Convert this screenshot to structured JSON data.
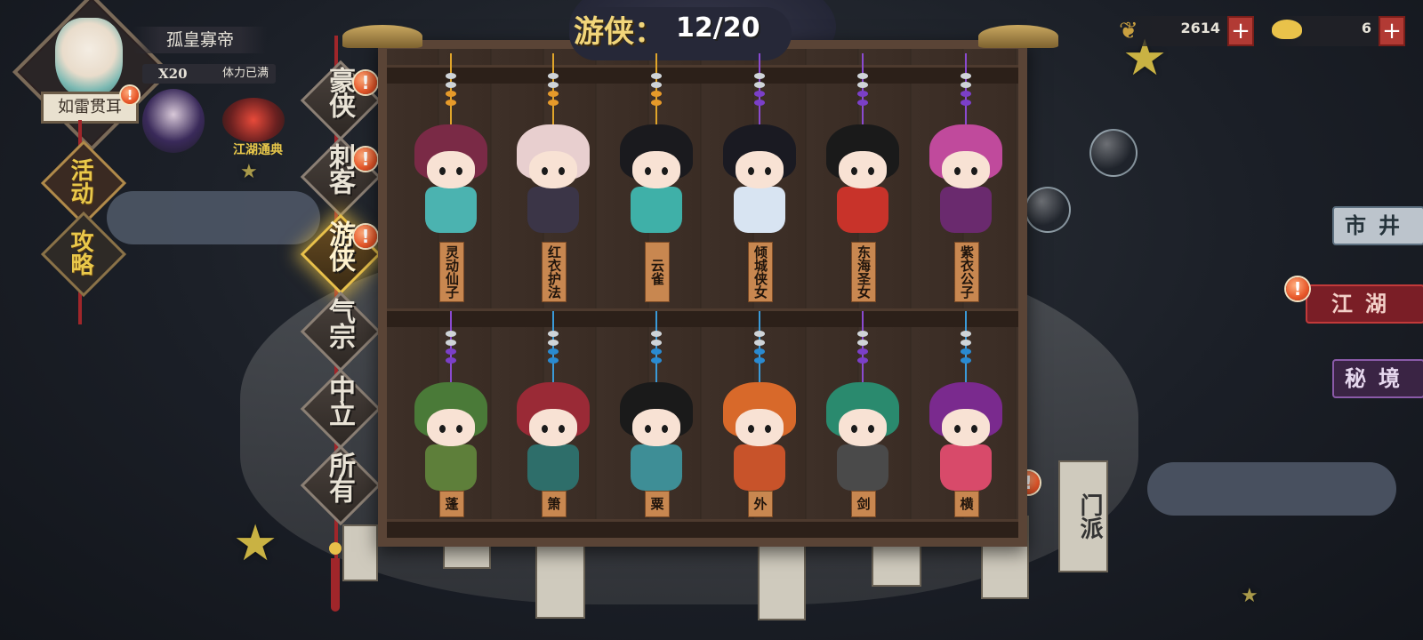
{
  "header": {
    "title": "游侠",
    "separator": "：",
    "count": "12/20"
  },
  "player": {
    "name": "孤皇寡帝",
    "stamina_count": "X20",
    "stamina_state": "体力已满",
    "title": "如雷贯耳"
  },
  "left_menu": {
    "activity": "活动",
    "strategy": "攻略",
    "codex": "江湖通典"
  },
  "categories": [
    {
      "label": "豪侠",
      "badge": "!"
    },
    {
      "label": "刺客",
      "badge": "!"
    },
    {
      "label": "游侠",
      "badge": "!"
    },
    {
      "label": "气宗",
      "badge": ""
    },
    {
      "label": "中立",
      "badge": ""
    },
    {
      "label": "所有",
      "badge": ""
    }
  ],
  "characters_row1": [
    {
      "name": "灵动仙子",
      "hair": "#7a2a46",
      "torso": "#4bb3b0",
      "string": "#e0a52a",
      "bead": "#e69a2a"
    },
    {
      "name": "红衣护法",
      "hair": "#e8cfcf",
      "torso": "#3b3547",
      "string": "#e0a52a",
      "bead": "#e69a2a"
    },
    {
      "name": "云雀",
      "hair": "#1a1a1e",
      "torso": "#3fb0a8",
      "string": "#e0a52a",
      "bead": "#e69a2a"
    },
    {
      "name": "倾城侠女",
      "hair": "#1a1a22",
      "torso": "#d8e4f2",
      "string": "#8a4ad0",
      "bead": "#7b3fc8"
    },
    {
      "name": "东海圣女",
      "hair": "#1a1a1a",
      "torso": "#c8332a",
      "string": "#8a4ad0",
      "bead": "#7b3fc8"
    },
    {
      "name": "紫衣公子",
      "hair": "#c04a9c",
      "torso": "#6a2a6e",
      "string": "#8a4ad0",
      "bead": "#7b3fc8"
    }
  ],
  "characters_row2": [
    {
      "name": "蓬",
      "hair": "#4a7a38",
      "torso": "#5e7f3a",
      "string": "#8a4ad0",
      "bead": "#7b3fc8"
    },
    {
      "name": "箫",
      "hair": "#9a2a36",
      "torso": "#2e6e6a",
      "string": "#3a9ad8",
      "bead": "#2a8ad0"
    },
    {
      "name": "粟",
      "hair": "#1a1a1a",
      "torso": "#3e8e96",
      "string": "#3a9ad8",
      "bead": "#2a8ad0"
    },
    {
      "name": "外",
      "hair": "#d8692a",
      "torso": "#c8532a",
      "string": "#3a9ad8",
      "bead": "#2a8ad0"
    },
    {
      "name": "剑",
      "hair": "#2a8a6e",
      "torso": "#4a4a4a",
      "string": "#8a4ad0",
      "bead": "#7b3fc8"
    },
    {
      "name": "横",
      "hair": "#7a2a8e",
      "torso": "#d84a6a",
      "string": "#3a9ad8",
      "bead": "#2a8ad0"
    }
  ],
  "currency": {
    "leaves": "2614",
    "gold": "6",
    "plus": "+"
  },
  "right_nav": {
    "market": "市井",
    "jianghu": "江湖",
    "secret": "秘境"
  },
  "sect": "门派",
  "colors": {
    "accent_gold": "#e8c04a",
    "badge_orange": "#e8582a",
    "cabinet_wood": "#3e3028"
  }
}
